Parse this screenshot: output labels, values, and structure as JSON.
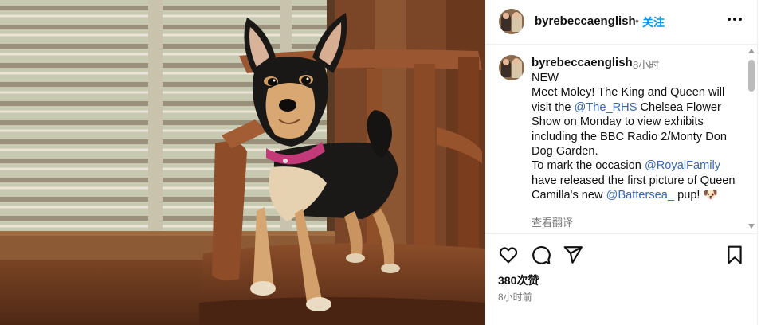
{
  "post": {
    "username": "byrebeccaenglish",
    "follow_label": "关注",
    "separator": "•",
    "more_label": "More options"
  },
  "caption": {
    "username": "byrebeccaenglish",
    "time": "8小时",
    "line_new": "NEW",
    "text_1": "Meet Moley! The King and Queen will visit the ",
    "mention_rhs": "@The_RHS",
    "text_2": " Chelsea Flower Show on Monday to view exhibits including the BBC Radio 2/Monty Don Dog Garden.",
    "text_3": "To mark the occasion ",
    "mention_royal": "@RoyalFamily",
    "text_4": " have released the first picture of Queen Camilla's new ",
    "mention_battersea": "@Battersea_",
    "text_5": " pup! 🐶",
    "translate_label": "查看翻译"
  },
  "engagement": {
    "likes": "380次赞",
    "time_ago": "8小时前"
  },
  "icons": [
    "heart-icon",
    "comment-icon",
    "share-icon",
    "bookmark-icon",
    "more-icon"
  ]
}
